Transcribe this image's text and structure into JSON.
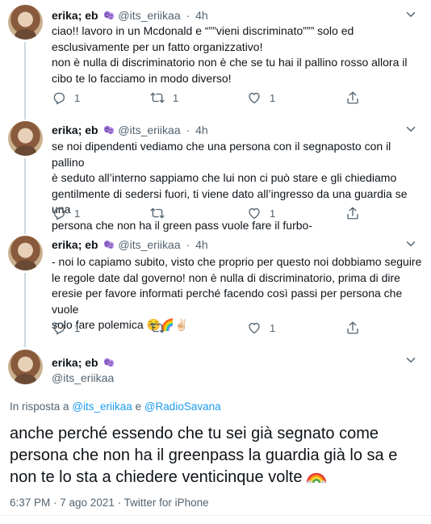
{
  "tweets": [
    {
      "display_name": "erika; eb",
      "handle": "@its_eriikaa",
      "dot": "·",
      "time": "4h",
      "text_lines": [
        "ciao!! lavoro in un Mcdonald e “””vieni discriminato””” solo ed",
        "esclusivamente per un fatto organizzativo!",
        "non è nulla di discriminatorio non è che se tu hai il pallino rosso allora il",
        "cibo te lo facciamo in modo diverso!"
      ],
      "reply_count": "1",
      "retweet_count": "1",
      "like_count": "1"
    },
    {
      "display_name": "erika; eb",
      "handle": "@its_eriikaa",
      "dot": "·",
      "time": "4h",
      "text_lines": [
        "se noi dipendenti vediamo che una persona con il segnaposto con il pallino",
        "è seduto all’interno sappiamo che lui non ci può stare e gli chiediamo",
        "gentilmente di sedersi fuori, ti viene dato all’ingresso da una guardia se una",
        "persona che non ha il green pass vuole fare il furbo-"
      ],
      "reply_count": "1",
      "retweet_count": "",
      "like_count": "1"
    },
    {
      "display_name": "erika; eb",
      "handle": "@its_eriikaa",
      "dot": "·",
      "time": "4h",
      "text_lines": [
        "- noi lo capiamo subito, visto che proprio per questo noi dobbiamo seguire",
        "le regole date dal governo! non è nulla di discriminatorio, prima di dire",
        "eresie per favore informati perché facendo così passi per persona che vuole",
        "solo fare polemica ☺️🌈✌🏻"
      ],
      "reply_count": "1",
      "retweet_count": "",
      "like_count": "1"
    }
  ],
  "main": {
    "display_name": "erika; eb",
    "handle": "@its_eriikaa",
    "reply_prefix": "In risposta a",
    "reply_mention_1": "@its_eriikaa",
    "reply_and": "e",
    "reply_mention_2": "@RadioSavana",
    "text_lines": [
      "anche perché essendo che tu sei già segnato come",
      "persona che non ha il greenpass la guardia già lo sa e",
      "non te lo sta a chiedere venticinque volte"
    ],
    "timestamp": "6:37 PM · 7 ago 2021 · Twitter for iPhone"
  },
  "colors": {
    "text": "#0f1419",
    "secondary": "#536471",
    "link": "#1d9bf0",
    "divider": "#eff3f4"
  },
  "icons": [
    "chevron-down-icon",
    "reply-icon",
    "retweet-icon",
    "like-icon",
    "share-icon",
    "theater-masks-emoji",
    "rainbow-emoji"
  ]
}
